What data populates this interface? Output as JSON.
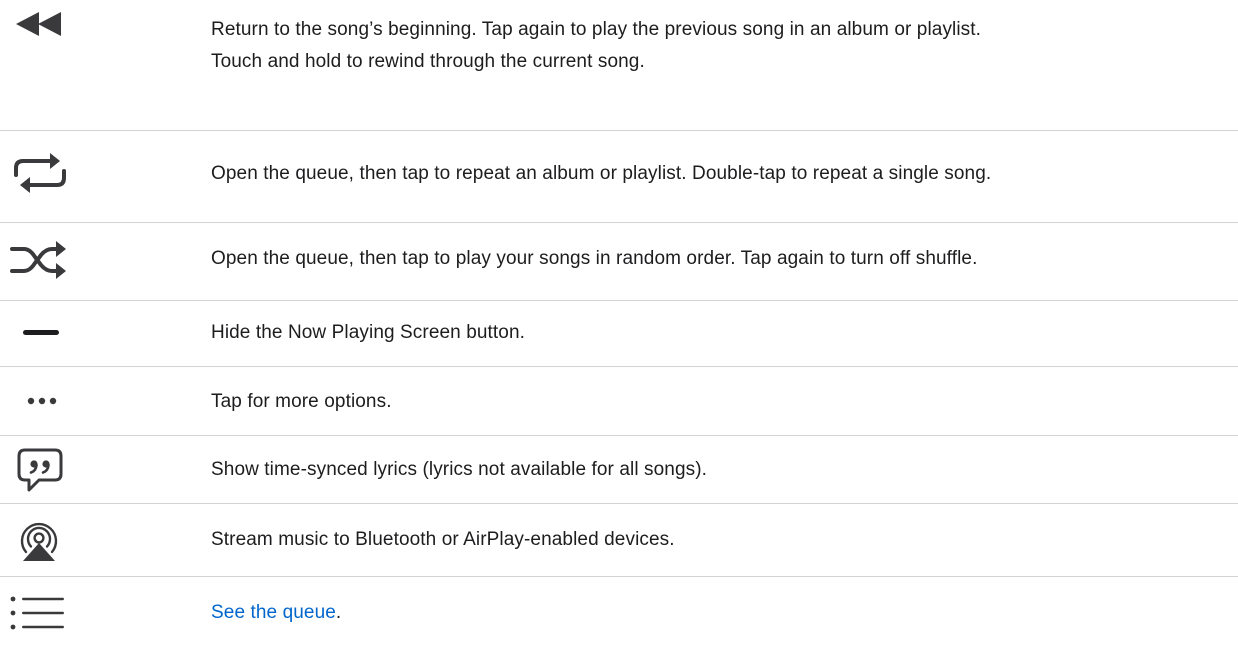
{
  "rows": [
    {
      "icon": "rewind-icon",
      "lines": [
        "Return to the song’s beginning. Tap again to play the previous song in an album or playlist.",
        "Touch and hold to rewind through the current song."
      ]
    },
    {
      "icon": "repeat-icon",
      "text": "Open the queue, then tap to repeat an album or playlist. Double-tap to repeat a single song."
    },
    {
      "icon": "shuffle-icon",
      "text": "Open the queue, then tap to play your songs in random order. Tap again to turn off shuffle."
    },
    {
      "icon": "minus-icon",
      "text": "Hide the Now Playing Screen button."
    },
    {
      "icon": "ellipsis-icon",
      "text": "Tap for more options."
    },
    {
      "icon": "lyrics-quote-bubble-icon",
      "text": "Show time-synced lyrics (lyrics not available for all songs)."
    },
    {
      "icon": "airplay-icon",
      "text": "Stream music to Bluetooth or AirPlay-enabled devices."
    },
    {
      "icon": "queue-list-icon",
      "link_text": "See the queue",
      "trailing": "."
    }
  ],
  "colors": {
    "text": "#1d1d1f",
    "icon": "#3a3a3c",
    "link": "#0066cc",
    "divider": "#d2d2d7"
  }
}
